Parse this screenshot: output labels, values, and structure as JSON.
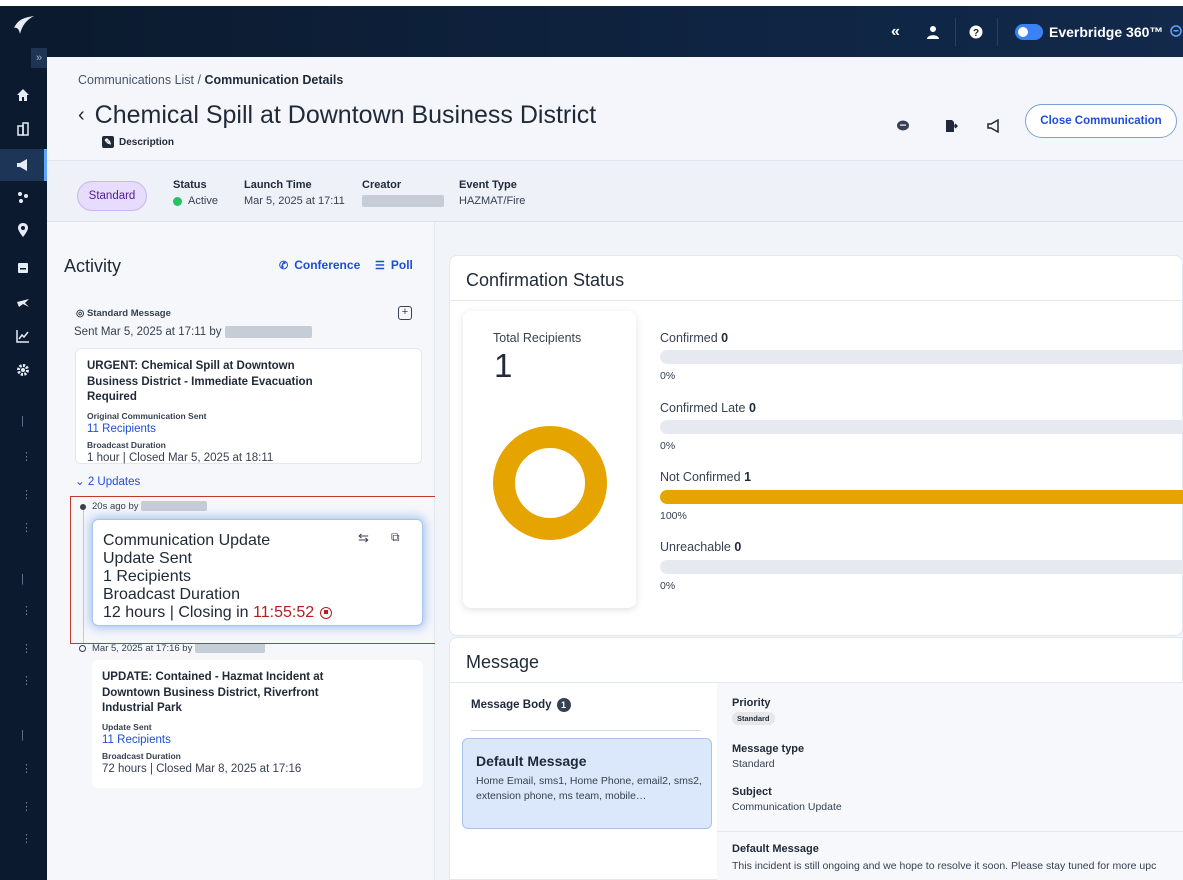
{
  "topbar": {
    "collapse_icon": "double-chevron-left-icon",
    "user_icon": "user-icon",
    "help_icon": "help-icon",
    "brand": "Everbridge 360™",
    "brand_icon": "chat-bubble-icon",
    "accent": "#3b82f6"
  },
  "sidebar": {
    "expand_label": "»",
    "icons": [
      "home-icon",
      "buildings-icon",
      "megaphone-icon",
      "people-network-icon",
      "location-pin-icon",
      "grid-icon",
      "plane-icon",
      "chart-icon",
      "gear-icon"
    ]
  },
  "header": {
    "breadcrumb_parent": "Communications List",
    "breadcrumb_sep": " / ",
    "breadcrumb_current": "Communication Details",
    "title": "Chemical Spill at Downtown Business District",
    "description_label": "Description",
    "close_button": "Close Communication"
  },
  "info": {
    "type_pill": "Standard",
    "status_label": "Status",
    "status_value": "Active",
    "launch_label": "Launch Time",
    "launch_value": "Mar 5, 2025 at 17:11",
    "creator_label": "Creator",
    "event_label": "Event Type",
    "event_value": "HAZMAT/Fire"
  },
  "activity": {
    "title": "Activity",
    "conference": "Conference",
    "poll": "Poll",
    "std_message_label": "Standard Message",
    "sent_text": "Sent Mar 5, 2025 at 17:11 by",
    "original": {
      "headline": "URGENT: Chemical Spill at Downtown Business District - Immediate Evacuation Required",
      "sent_label": "Original Communication Sent",
      "recipients": "11 Recipients",
      "duration_label": "Broadcast Duration",
      "duration": "1 hour | Closed Mar 5, 2025 at 18:11"
    },
    "updates_toggle": "2 Updates",
    "update1": {
      "ago": "20s ago by",
      "title": "Communication Update",
      "sent_label": "Update Sent",
      "recipients": "1 Recipients",
      "duration_label": "Broadcast Duration",
      "duration_prefix": "12 hours | Closing in",
      "countdown": "11:55:52"
    },
    "update2": {
      "time": "Mar 5, 2025 at 17:16 by",
      "headline": "UPDATE: Contained - Hazmat Incident at Downtown Business District, Riverfront Industrial Park",
      "sent_label": "Update Sent",
      "recipients": "11 Recipients",
      "duration_label": "Broadcast Duration",
      "duration": "72 hours | Closed Mar 8, 2025 at 17:16"
    }
  },
  "confirmation": {
    "title": "Confirmation Status",
    "total_label": "Total Recipients",
    "total_value": "1",
    "donut_color": "#e6a400",
    "stats": [
      {
        "label": "Confirmed",
        "count": "0",
        "percent_text": "0%",
        "fraction": 0
      },
      {
        "label": "Confirmed Late",
        "count": "0",
        "percent_text": "0%",
        "fraction": 0
      },
      {
        "label": "Not Confirmed",
        "count": "1",
        "percent_text": "100%",
        "fraction": 1
      },
      {
        "label": "Unreachable",
        "count": "0",
        "percent_text": "0%",
        "fraction": 0
      }
    ]
  },
  "message": {
    "title": "Message",
    "body_label": "Message Body",
    "body_count": "1",
    "default_title": "Default Message",
    "default_channels": "Home Email, sms1, Home Phone, email2, sms2, extension phone, ms team, mobile…",
    "priority_label": "Priority",
    "priority_value": "Standard",
    "type_label": "Message type",
    "type_value": "Standard",
    "subject_label": "Subject",
    "subject_value": "Communication Update",
    "default_label": "Default Message",
    "default_text": "This incident is still ongoing and we hope to resolve it soon. Please stay tuned for more upc"
  }
}
